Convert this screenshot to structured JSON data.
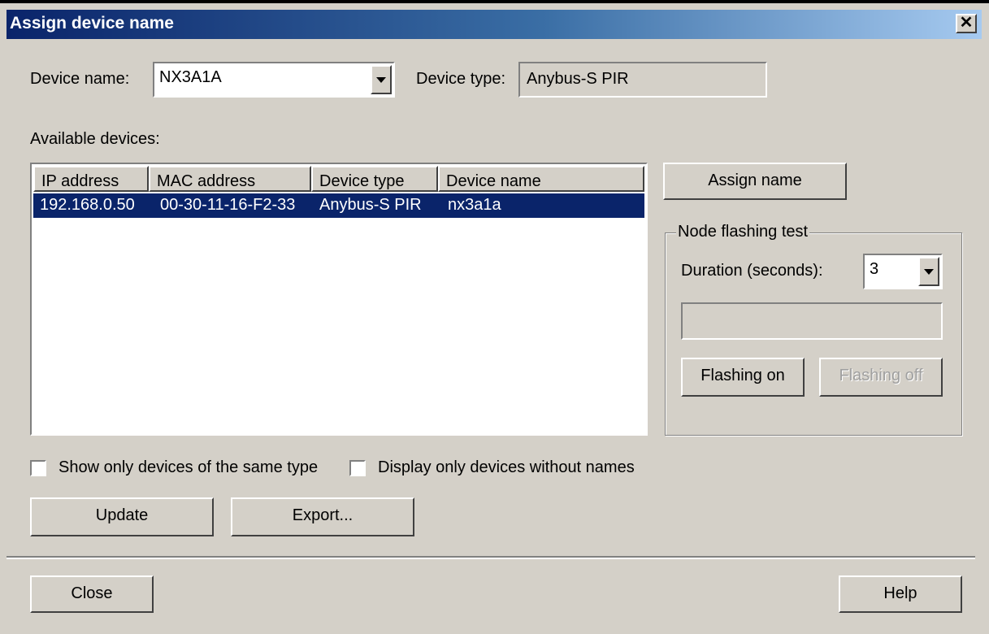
{
  "window": {
    "title": "Assign device name",
    "close_glyph": "✕"
  },
  "device_name": {
    "label": "Device name:",
    "value": "NX3A1A"
  },
  "device_type": {
    "label": "Device type:",
    "value": "Anybus-S PIR"
  },
  "available_devices": {
    "label": "Available devices:",
    "columns": [
      "IP address",
      "MAC address",
      "Device type",
      "Device name"
    ],
    "rows": [
      {
        "ip": "192.168.0.50",
        "mac": "00-30-11-16-F2-33",
        "type": "Anybus-S PIR",
        "name": "nx3a1a",
        "selected": true
      }
    ]
  },
  "assign_button": "Assign name",
  "flashing_test": {
    "label": "Node flashing test",
    "duration_label": "Duration (seconds):",
    "duration_value": "3",
    "flashing_on": "Flashing on",
    "flashing_off": "Flashing off"
  },
  "options": {
    "same_type": "Show only devices of the same type",
    "without_names": "Display only devices without names"
  },
  "buttons": {
    "update": "Update",
    "export": "Export...",
    "close": "Close",
    "help": "Help"
  },
  "colors": {
    "dialog": "#d4d0c8",
    "selection": "#0a246a",
    "title_start": "#0a246a",
    "title_end": "#a6caf0"
  }
}
